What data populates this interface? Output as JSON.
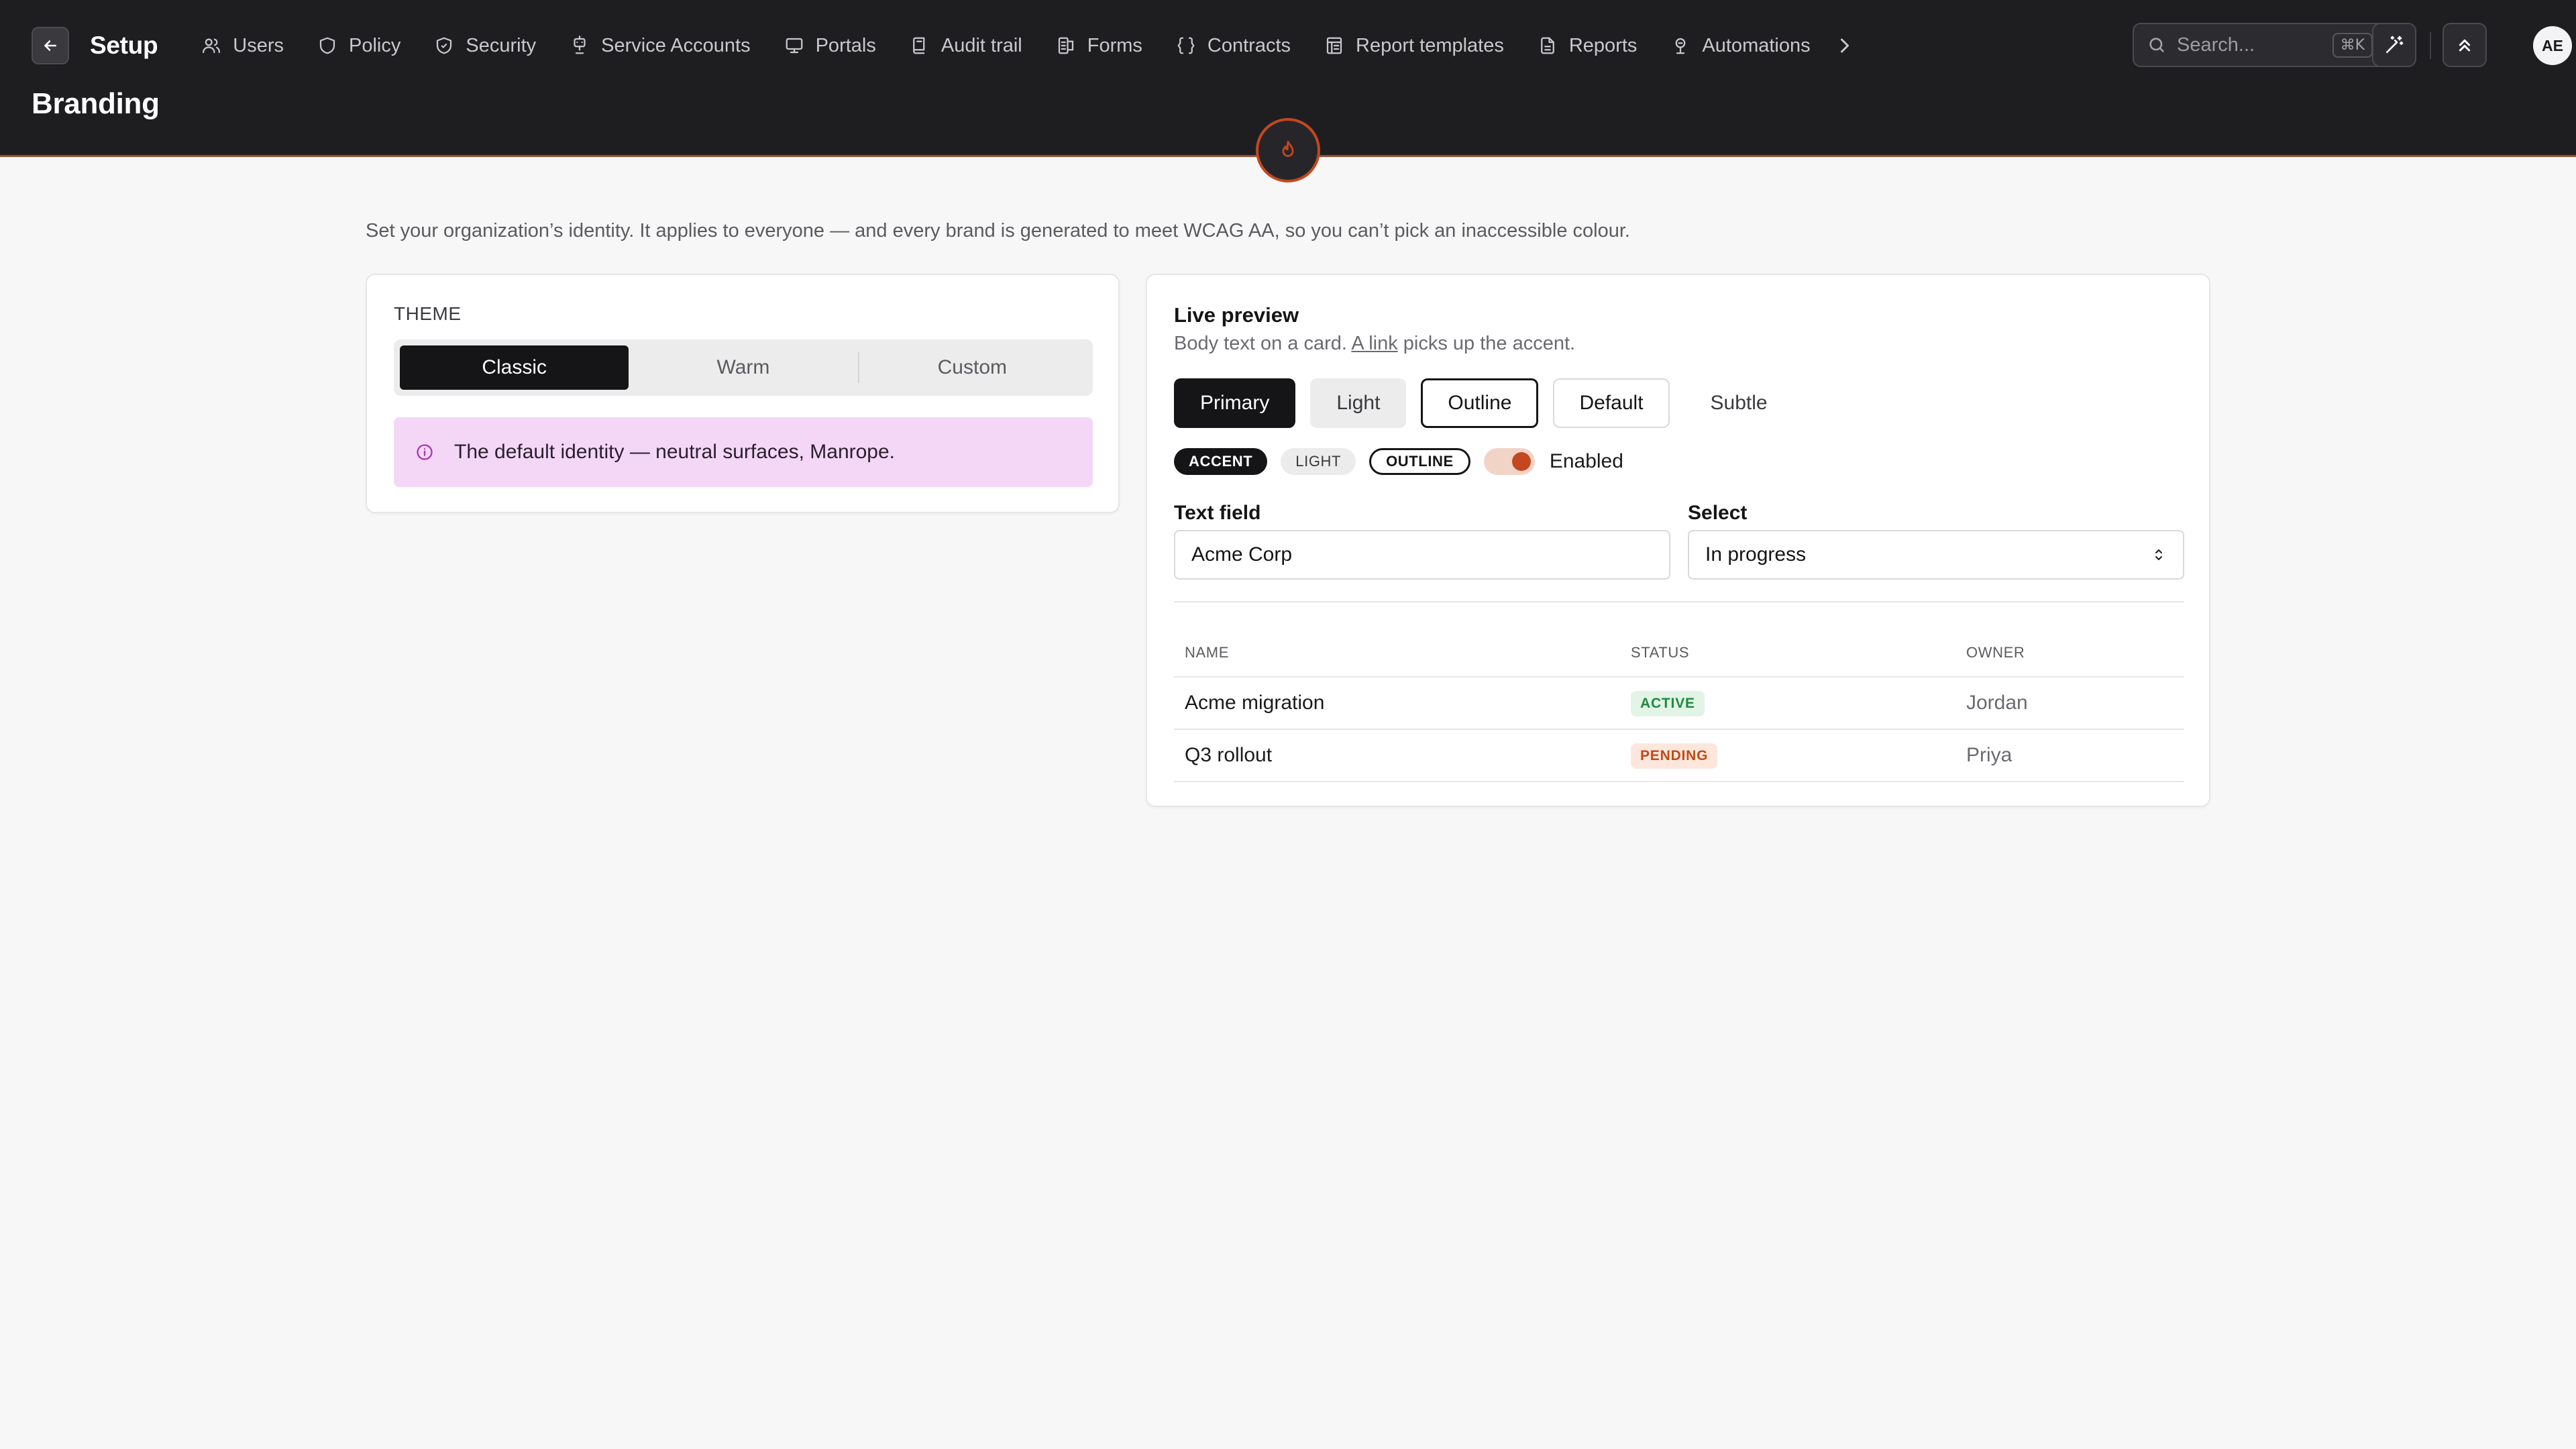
{
  "header": {
    "app_name": "Setup",
    "page_title": "Branding",
    "nav": [
      {
        "label": "Users",
        "icon": "users-icon"
      },
      {
        "label": "Policy",
        "icon": "policy-shield-icon"
      },
      {
        "label": "Security",
        "icon": "security-shield-icon"
      },
      {
        "label": "Service Accounts",
        "icon": "service-accounts-icon"
      },
      {
        "label": "Portals",
        "icon": "monitor-icon"
      },
      {
        "label": "Audit trail",
        "icon": "audit-icon"
      },
      {
        "label": "Forms",
        "icon": "forms-icon"
      },
      {
        "label": "Contracts",
        "icon": "braces-icon"
      },
      {
        "label": "Report templates",
        "icon": "report-template-icon"
      },
      {
        "label": "Reports",
        "icon": "document-icon"
      },
      {
        "label": "Automations",
        "icon": "automations-icon"
      }
    ],
    "search": {
      "placeholder": "Search...",
      "shortcut": "⌘K"
    },
    "avatar_initials": "AE"
  },
  "intro": "Set your organization’s identity. It applies to everyone — and every brand is generated to meet WCAG AA, so you can’t pick an inaccessible colour.",
  "theme": {
    "label": "THEME",
    "options": [
      "Classic",
      "Warm",
      "Custom"
    ],
    "selected": "Classic",
    "note": "The default identity — neutral surfaces, Manrope."
  },
  "preview": {
    "title": "Live preview",
    "body_before": "Body text on a card. ",
    "body_link": "A link",
    "body_after": " picks up the accent.",
    "buttons": {
      "primary": "Primary",
      "light": "Light",
      "outline": "Outline",
      "default": "Default",
      "subtle": "Subtle"
    },
    "badges": {
      "accent": "ACCENT",
      "light": "LIGHT",
      "outline": "OUTLINE"
    },
    "toggle": {
      "label": "Enabled",
      "on": true
    },
    "text_field": {
      "label": "Text field",
      "value": "Acme Corp"
    },
    "select": {
      "label": "Select",
      "value": "In progress"
    },
    "table": {
      "columns": [
        "NAME",
        "STATUS",
        "OWNER"
      ],
      "rows": [
        {
          "name": "Acme migration",
          "status": "ACTIVE",
          "owner": "Jordan"
        },
        {
          "name": "Q3 rollout",
          "status": "PENDING",
          "owner": "Priya"
        }
      ]
    }
  },
  "colors": {
    "header_bg": "#1e1e21",
    "accent": "#c4471f",
    "primary": "#151517",
    "note_bg": "#f4d7f7",
    "status_active": "#1e8a3d",
    "status_pending": "#c24a16"
  }
}
